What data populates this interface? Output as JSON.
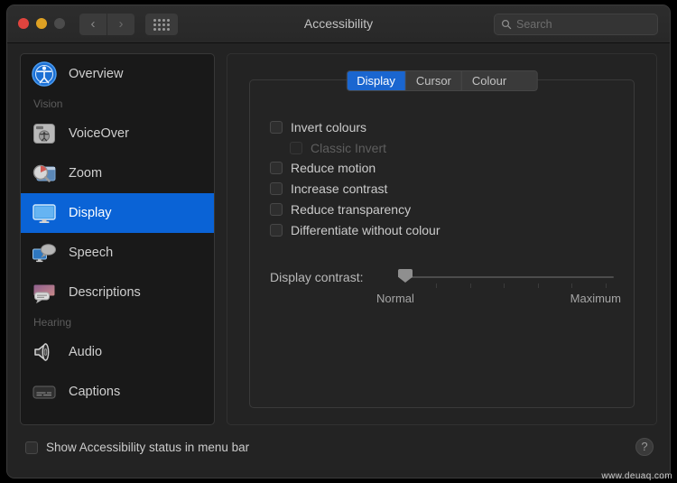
{
  "window": {
    "title": "Accessibility",
    "traffic_lights": [
      "close",
      "minimise",
      "zoom"
    ],
    "nav": {
      "back": "‹",
      "forward": "›"
    },
    "grid_icon": "grid-icon"
  },
  "search": {
    "placeholder": "Search",
    "value": "",
    "icon": "search-icon"
  },
  "sidebar": {
    "items": [
      {
        "type": "item",
        "label": "Overview",
        "icon": "accessibility-person-icon",
        "selected": false
      },
      {
        "type": "header",
        "label": "Vision"
      },
      {
        "type": "item",
        "label": "VoiceOver",
        "icon": "voiceover-icon",
        "selected": false
      },
      {
        "type": "item",
        "label": "Zoom",
        "icon": "zoom-magnifier-icon",
        "selected": false
      },
      {
        "type": "item",
        "label": "Display",
        "icon": "display-monitor-icon",
        "selected": true
      },
      {
        "type": "item",
        "label": "Speech",
        "icon": "speech-bubble-monitor-icon",
        "selected": false
      },
      {
        "type": "item",
        "label": "Descriptions",
        "icon": "descriptions-icon",
        "selected": false
      },
      {
        "type": "header",
        "label": "Hearing"
      },
      {
        "type": "item",
        "label": "Audio",
        "icon": "speaker-icon",
        "selected": false
      },
      {
        "type": "item",
        "label": "Captions",
        "icon": "captions-icon",
        "selected": false
      }
    ]
  },
  "main": {
    "tabs": [
      {
        "label": "Display",
        "active": true
      },
      {
        "label": "Cursor",
        "active": false
      },
      {
        "label": "Colour Filters",
        "active": false
      }
    ],
    "checkboxes": [
      {
        "label": "Invert colours",
        "checked": false,
        "disabled": false,
        "indented": false
      },
      {
        "label": "Classic Invert",
        "checked": false,
        "disabled": true,
        "indented": true
      },
      {
        "label": "Reduce motion",
        "checked": false,
        "disabled": false,
        "indented": false
      },
      {
        "label": "Increase contrast",
        "checked": false,
        "disabled": false,
        "indented": false
      },
      {
        "label": "Reduce transparency",
        "checked": false,
        "disabled": false,
        "indented": false
      },
      {
        "label": "Differentiate without colour",
        "checked": false,
        "disabled": false,
        "indented": false
      }
    ],
    "slider": {
      "label": "Display contrast:",
      "min_label": "Normal",
      "max_label": "Maximum",
      "value": 0,
      "ticks": 6
    }
  },
  "bottom": {
    "show_status_label": "Show Accessibility status in menu bar",
    "show_status_checked": false,
    "help_label": "?"
  },
  "watermark": "www.deuaq.com",
  "colors": {
    "accent": "#0a63d6",
    "tab_active": "#1a66d0",
    "window_bg": "#232323",
    "sidebar_bg": "#191919"
  }
}
